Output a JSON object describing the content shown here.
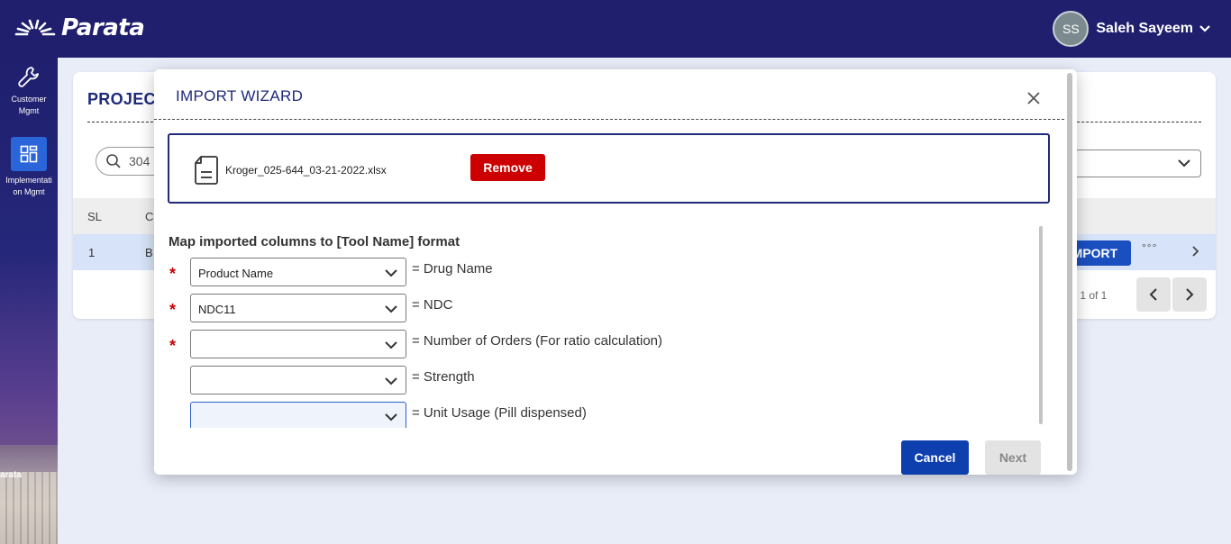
{
  "header": {
    "brand": "Parata",
    "user_initials": "SS",
    "user_name": "Saleh Sayeem"
  },
  "sidebar": {
    "items": [
      {
        "label_line1": "Customer",
        "label_line2": "Mgmt",
        "icon": "wrench-icon",
        "active": false
      },
      {
        "label_line1": "Implementati",
        "label_line2": "on Mgmt",
        "icon": "dashboard-grid-icon",
        "active": true
      }
    ],
    "building_text": "arata"
  },
  "page": {
    "title": "PROJECT",
    "search_value": "304",
    "table": {
      "headers": [
        "SL",
        "C"
      ],
      "rows": [
        {
          "sl": "1",
          "c": "B"
        }
      ],
      "row_action_label": "IMPORT",
      "more_label": "°°°"
    },
    "pager_text": "- 1 of 1"
  },
  "modal": {
    "title": "IMPORT WIZARD",
    "file_name": "Kroger_025-644_03-21-2022.xlsx",
    "remove_label": "Remove",
    "map_title": "Map imported columns to [Tool Name] format",
    "mappings": [
      {
        "required": true,
        "selected": "Product Name",
        "target": "= Drug Name"
      },
      {
        "required": true,
        "selected": "NDC11",
        "target": "= NDC"
      },
      {
        "required": true,
        "selected": "",
        "target": "= Number of Orders (For ratio calculation)"
      },
      {
        "required": false,
        "selected": "",
        "target": "= Strength"
      },
      {
        "required": false,
        "selected": "",
        "target": "= Unit Usage (Pill dispensed)",
        "focused": true
      }
    ],
    "required_marker": "*",
    "cancel_label": "Cancel",
    "next_label": "Next"
  },
  "colors": {
    "header_bg": "#1f1f6e",
    "primary_blue": "#0e3fae",
    "remove_red": "#cc0000",
    "title_navy": "#1f2a7a"
  }
}
